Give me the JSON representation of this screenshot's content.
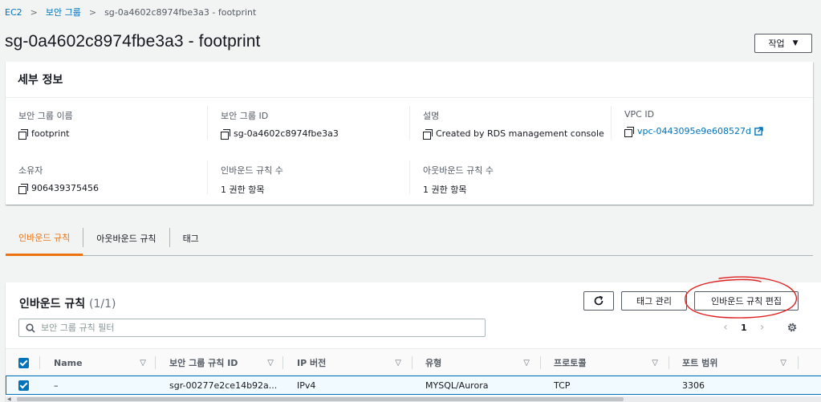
{
  "breadcrumb": {
    "items": [
      "EC2",
      "보안 그룹",
      "sg-0a4602c8974fbe3a3 - footprint"
    ]
  },
  "page": {
    "title": "sg-0a4602c8974fbe3a3 - footprint",
    "action_button": "작업"
  },
  "details": {
    "header": "세부 정보",
    "fields": {
      "sg_name_label": "보안 그룹 이름",
      "sg_name_value": "footprint",
      "sg_id_label": "보안 그룹 ID",
      "sg_id_value": "sg-0a4602c8974fbe3a3",
      "description_label": "설명",
      "description_value": "Created by RDS management console",
      "vpc_label": "VPC ID",
      "vpc_value": "vpc-0443095e9e608527d",
      "owner_label": "소유자",
      "owner_value": "906439375456",
      "inbound_count_label": "인바운드 규칙 수",
      "inbound_count_value": "1 권한 항목",
      "outbound_count_label": "아웃바운드 규칙 수",
      "outbound_count_value": "1 권한 항목"
    }
  },
  "tabs": [
    "인바운드 규칙",
    "아웃바운드 규칙",
    "태그"
  ],
  "rules": {
    "title": "인바운드 규칙",
    "count": "(1/1)",
    "tag_button": "태그 관리",
    "edit_button": "인바운드 규칙 편집",
    "filter_placeholder": "보안 그룹 규칙 필터",
    "page_number": "1",
    "columns": [
      "Name",
      "보안 그룹 규칙 ID",
      "IP 버전",
      "유형",
      "프로토콜",
      "포트 범위"
    ],
    "rows": [
      {
        "name": "–",
        "rule_id": "sgr-00277e2ce14b92a...",
        "ip_version": "IPv4",
        "type": "MYSQL/Aurora",
        "protocol": "TCP",
        "port_range": "3306"
      }
    ]
  },
  "colors": {
    "link": "#0073bb",
    "active_tab": "#ec7211",
    "annotation": "#e02020"
  },
  "icons": [
    "chevron-right-icon",
    "caret-down-icon",
    "copy-icon",
    "external-link-icon",
    "refresh-icon",
    "search-icon",
    "chevron-left-icon",
    "gear-icon",
    "sort-icon",
    "checkbox-icon"
  ]
}
